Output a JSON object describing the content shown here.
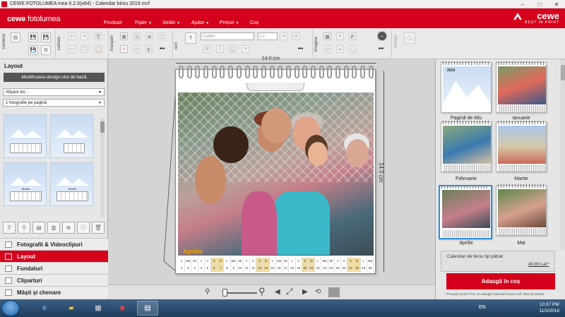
{
  "window": {
    "title": "CEWE FOTOLUMEA mea 6.2.6(x64) - Calendar birou 2019.mcf",
    "min": "–",
    "max": "□",
    "close": "✕"
  },
  "brand": {
    "app_bold": "cewe",
    "app_light": "fotolumea",
    "logo_name": "cewe",
    "logo_tagline": "BEST IN PRINT"
  },
  "menu": [
    {
      "label": "Produse"
    },
    {
      "label": "Fişier"
    },
    {
      "label": "Setări"
    },
    {
      "label": "Ajutor"
    },
    {
      "label": "Prețuri"
    },
    {
      "label": "Coș"
    }
  ],
  "toolbar": {
    "section_general": "General",
    "section_editare": "Editare",
    "section_aranjare": "Aranjare",
    "section_text": "Text",
    "section_imagine": "Imagine",
    "section_umbra": "Umbră",
    "font_name": "Calibri",
    "font_size": "12",
    "bold": "B",
    "italic": "I",
    "underline": "U"
  },
  "left": {
    "title": "Layout",
    "modify_button": "Modificarea design-ului de bază",
    "display_select": "Afişare tot...",
    "photos_select": "1 fotografie pe pagină",
    "thumbs": [
      {
        "label": ""
      },
      {
        "label": ""
      },
      {
        "label": "Month"
      },
      {
        "label": "Month"
      }
    ],
    "accordion": [
      {
        "label": "Fotografii & Videoclipuri",
        "active": false
      },
      {
        "label": "Layout",
        "active": true
      },
      {
        "label": "Fundaluri",
        "active": false
      },
      {
        "label": "Cliparturi",
        "active": false
      },
      {
        "label": "Măști și chenare",
        "active": false
      }
    ]
  },
  "canvas": {
    "ruler_x": "14.0.cm",
    "ruler_y": "14.0 cm",
    "month_name": "Aprilie",
    "days_row1": [
      "L",
      "Ma",
      "Mi",
      "J",
      "V",
      "S",
      "D",
      "L",
      "Ma",
      "Mi",
      "J",
      "V",
      "S",
      "D",
      "L",
      "Ma",
      "Mi",
      "J",
      "V",
      "S",
      "D",
      "L",
      "Ma",
      "Mi",
      "J",
      "V",
      "S",
      "D",
      "L",
      "Ma"
    ],
    "days_row2": [
      "1",
      "2",
      "3",
      "4",
      "5",
      "6",
      "7",
      "8",
      "9",
      "10",
      "11",
      "12",
      "13",
      "14",
      "15",
      "16",
      "17",
      "18",
      "19",
      "20",
      "21",
      "22",
      "23",
      "24",
      "25",
      "26",
      "27",
      "28",
      "29",
      "30"
    ]
  },
  "right": {
    "pages": [
      {
        "label": "Pagină de titlu",
        "year": "2019"
      },
      {
        "label": "Ianuarie"
      },
      {
        "label": "Februarie"
      },
      {
        "label": "Martie"
      },
      {
        "label": "Aprilie"
      },
      {
        "label": "Mai"
      }
    ],
    "product_name": "Calendar de birou tip pătrat",
    "price": "49,90 Lei*",
    "add_button": "Adaugă în coș",
    "note": "* Prețurile includ TVA; se adaugă costul de livrare conf. listei de prețuri."
  },
  "taskbar": {
    "lang": "EN",
    "time": "10:37 PM",
    "date": "11/5/2018"
  }
}
